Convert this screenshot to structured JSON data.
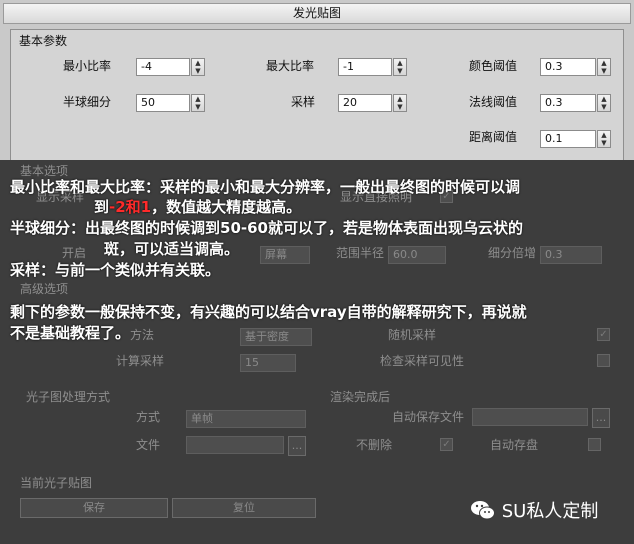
{
  "window": {
    "title": "发光贴图"
  },
  "basic": {
    "group_label": "基本参数",
    "min_rate_label": "最小比率",
    "min_rate": "-4",
    "max_rate_label": "最大比率",
    "max_rate": "-1",
    "color_thresh_label": "颜色阈值",
    "color_thresh": "0.3",
    "hsph_label": "半球细分",
    "hsph": "50",
    "samples_label": "采样",
    "samples": "20",
    "normal_thresh_label": "法线阈值",
    "normal_thresh": "0.3",
    "dist_thresh_label": "距离阈值",
    "dist_thresh": "0.1"
  },
  "options": {
    "group_label": "基本选项",
    "show_calc_label": "显示采样",
    "show_direct_label": "显示直接照明",
    "on_label": "开启",
    "mode_value": "屏幕",
    "radius_label": "范围半径",
    "radius": "60.0",
    "subdiv_mult_label": "细分倍增",
    "subdiv_mult": "0.3"
  },
  "advanced": {
    "group_label": "高级选项",
    "method_label": "方法",
    "method_value": "基于密度",
    "random_label": "随机采样",
    "calc_samples_label": "计算采样",
    "calc_samples": "15",
    "check_vis_label": "检查采样可见性"
  },
  "photon": {
    "group_label": "光子图处理方式",
    "mode_label": "方式",
    "mode_value": "单帧",
    "file_label": "文件",
    "browse": "...",
    "after_label": "渲染完成后",
    "autosave_label": "自动保存文件",
    "nodelete_label": "不删除",
    "autoswitch_label": "自动存盘"
  },
  "current": {
    "group_label": "当前光子贴图",
    "save_btn": "保存",
    "reset_btn": "复位"
  },
  "captions": {
    "c1a": "最小比率和最大比率：采样的最小和最大分辨率，一般出最终图的时候可以调",
    "c1b_pre": "到",
    "c1b_red": "-2和1",
    "c1b_post": "，数值越大精度越高。",
    "c2a": "半球细分：出最终图的时候调到50-60就可以了，若是物体表面出现乌云状的",
    "c2b": "斑，可以适当调高。",
    "c3": "采样：与前一个类似并有关联。",
    "c4a": "剩下的参数一般保持不变，有兴趣的可以结合vray自带的解释研究下，再说就",
    "c4b": "不是基础教程了。"
  },
  "watermark": "SU私人定制"
}
